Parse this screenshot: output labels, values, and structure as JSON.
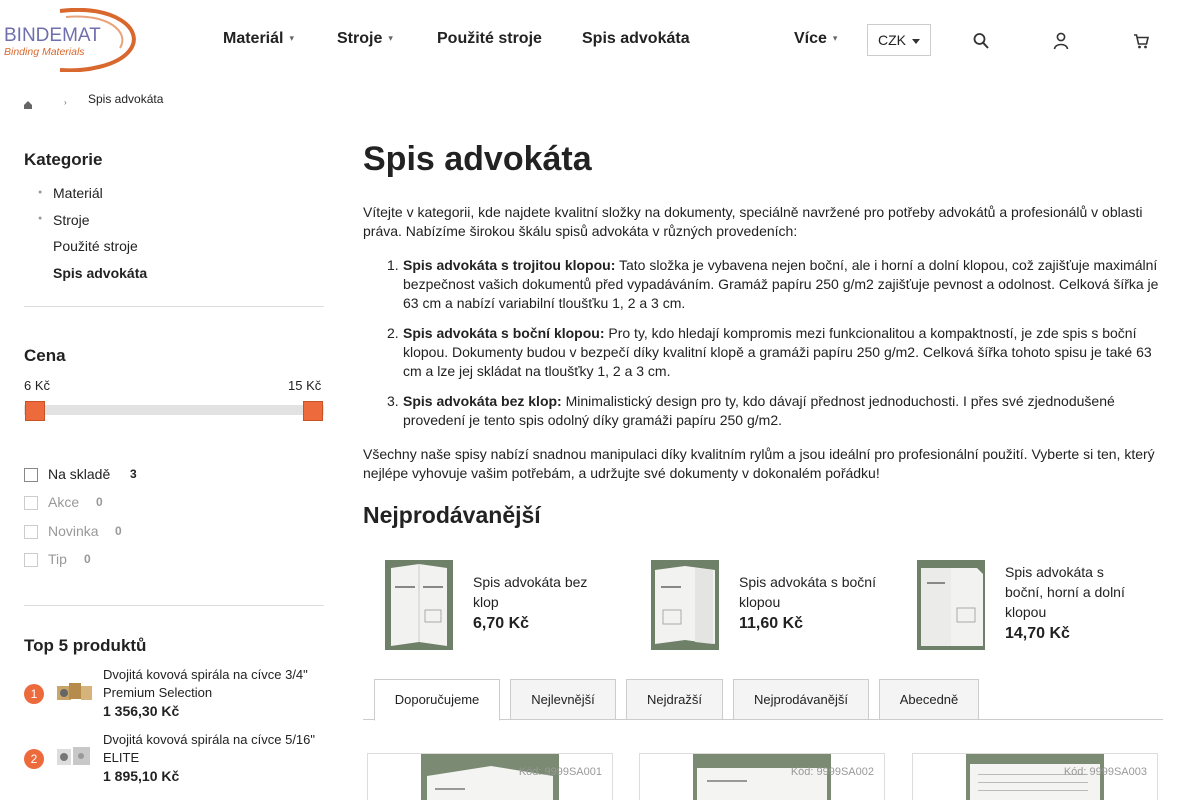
{
  "logo": {
    "name": "BINDEMAT",
    "tagline": "Binding Materials"
  },
  "nav": {
    "items": [
      {
        "label": "Materiál"
      },
      {
        "label": "Stroje"
      },
      {
        "label": "Použité stroje"
      },
      {
        "label": "Spis advokáta"
      },
      {
        "label": "Více"
      }
    ],
    "currency": "CZK"
  },
  "breadcrumb": {
    "current": "Spis advokáta"
  },
  "sidebar": {
    "categories_title": "Kategorie",
    "categories": [
      {
        "label": "Materiál"
      },
      {
        "label": "Stroje"
      },
      {
        "label": "Použité stroje"
      },
      {
        "label": "Spis advokáta"
      }
    ],
    "price_title": "Cena",
    "price_min": "6 Kč",
    "price_max": "15 Kč",
    "filters": [
      {
        "label": "Na skladě",
        "count": "3"
      },
      {
        "label": "Akce",
        "count": "0"
      },
      {
        "label": "Novinka",
        "count": "0"
      },
      {
        "label": "Tip",
        "count": "0"
      }
    ],
    "top_title": "Top 5 produktů",
    "top": [
      {
        "rank": "1",
        "name": "Dvojitá kovová spirála na cívce 3/4\" Premium Selection",
        "price": "1 356,30 Kč"
      },
      {
        "rank": "2",
        "name": "Dvojitá kovová spirála na cívce 5/16\" ELITE",
        "price": "1 895,10 Kč"
      }
    ]
  },
  "main": {
    "title": "Spis advokáta",
    "intro": "Vítejte v kategorii, kde najdete kvalitní složky na dokumenty, speciálně navržené pro potřeby advokátů a profesionálů v oblasti práva. Nabízíme širokou škálu spisů advokáta v různých provedeních:",
    "list": [
      {
        "num": "1.",
        "bold": "Spis advokáta s trojitou klopou:",
        "text": " Tato složka je vybavena nejen boční, ale i horní a dolní klopou, což zajišťuje maximální bezpečnost vašich dokumentů před vypadáváním. Gramáž papíru 250 g/m2 zajišťuje pevnost a odolnost. Celková šířka je 63 cm a nabízí variabilní tloušťku 1, 2 a 3 cm."
      },
      {
        "num": "2.",
        "bold": "Spis advokáta s boční klopou:",
        "text": " Pro ty, kdo hledají kompromis mezi funkcionalitou a kompaktností, je zde spis s boční klopou. Dokumenty budou v bezpečí díky kvalitní klopě a gramáži papíru 250 g/m2. Celková šířka tohoto spisu je také 63 cm a lze jej skládat na tloušťky 1, 2 a 3 cm."
      },
      {
        "num": "3.",
        "bold": "Spis advokáta bez klop:",
        "text": " Minimalistický design pro ty, kdo dávají přednost jednoduchosti. I přes své zjednodušené provedení je tento spis odolný díky gramáži papíru 250 g/m2."
      }
    ],
    "outro": "Všechny naše spisy nabízí snadnou manipulaci díky kvalitním rylům a jsou ideální pro profesionální použití. Vyberte si ten, který nejlépe vyhovuje vašim potřebám, a udržujte své dokumenty v dokonalém pořádku!",
    "bestsellers_title": "Nejprodávanější",
    "bestsellers": [
      {
        "name": "Spis advokáta bez klop",
        "price": "6,70 Kč"
      },
      {
        "name": "Spis advokáta s boční klopou",
        "price": "11,60 Kč"
      },
      {
        "name": "Spis advokáta s boční, horní a dolní klopou",
        "price": "14,70 Kč"
      }
    ],
    "tabs": [
      {
        "label": "Doporučujeme"
      },
      {
        "label": "Nejlevnější"
      },
      {
        "label": "Nejdražší"
      },
      {
        "label": "Nejprodávanější"
      },
      {
        "label": "Abecedně"
      }
    ],
    "products": [
      {
        "code": "Kód: 9999SA001"
      },
      {
        "code": "Kód: 9999SA002"
      },
      {
        "code": "Kód: 9999SA003"
      }
    ]
  },
  "colors": {
    "accent": "#ec6a3c",
    "text": "#222222"
  }
}
